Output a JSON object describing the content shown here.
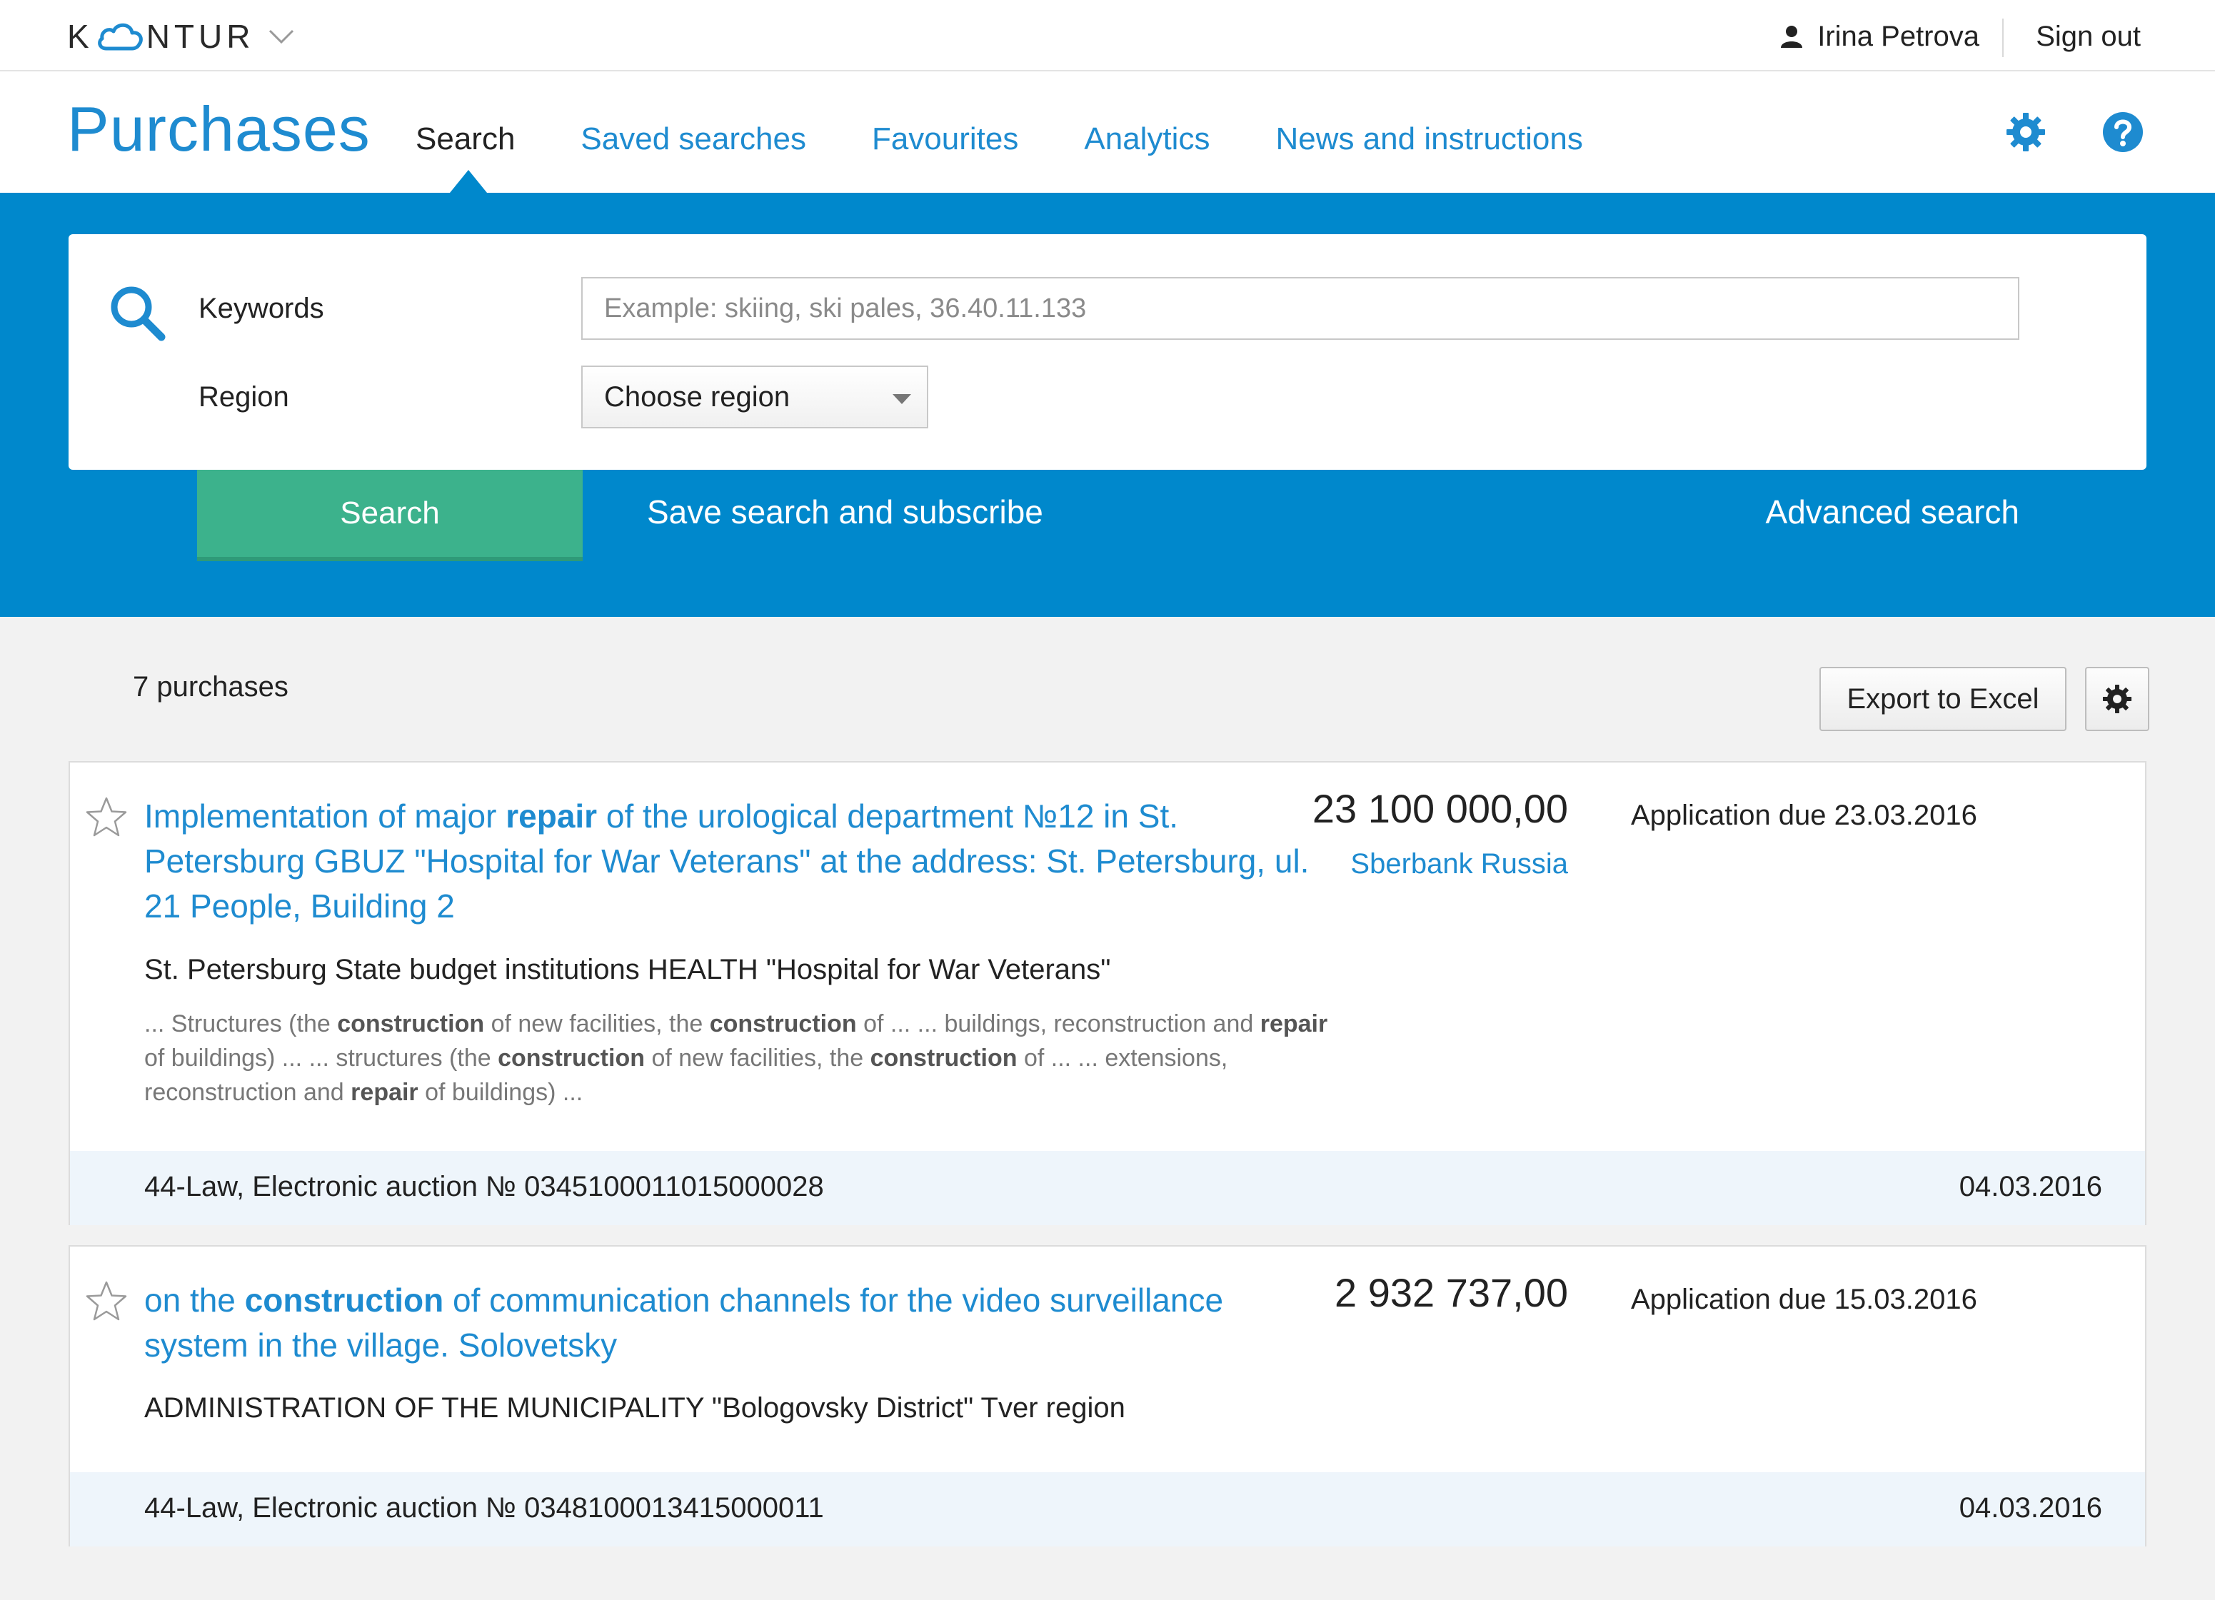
{
  "brand": {
    "logo_text_left": "K",
    "logo_text_right": "NTUR"
  },
  "user": {
    "name": "Irina Petrova",
    "sign_out": "Sign out"
  },
  "nav": {
    "product_title": "Purchases",
    "tabs": [
      {
        "label": "Search",
        "active": true
      },
      {
        "label": "Saved searches",
        "active": false
      },
      {
        "label": "Favourites",
        "active": false
      },
      {
        "label": "Analytics",
        "active": false
      },
      {
        "label": "News and instructions",
        "active": false
      }
    ]
  },
  "search": {
    "keywords_label": "Keywords",
    "keywords_placeholder": "Example: skiing, ski pales, 36.40.11.133",
    "keywords_value": "",
    "region_label": "Region",
    "region_value": "Choose region",
    "search_button": "Search",
    "save_link": "Save search and subscribe",
    "advanced_link": "Advanced search"
  },
  "results": {
    "count_text": "7 purchases",
    "export_button": "Export to Excel",
    "items": [
      {
        "title_parts": [
          "Implementation of major ",
          "repair",
          " of the urological department №12 in St. Petersburg GBUZ \"Hospital for War Veterans\" at the address: St. Petersburg, ul. 21 People, Building 2"
        ],
        "price": "23 100 000,00",
        "bank": "Sberbank Russia",
        "due": "Application due 23.03.2016",
        "org": "St. Petersburg State budget institutions HEALTH \"Hospital for War Veterans\"",
        "snippet_parts": [
          "... Structures (the ",
          "construction",
          " of new facilities, the ",
          "construction",
          " of ... ... buildings, reconstruction and ",
          "repair",
          " of buildings) ... ... structures (the ",
          "construction",
          " of new facilities, the ",
          "construction",
          " of ... ... extensions, reconstruction and ",
          "repair",
          " of buildings) ..."
        ],
        "law": "44-Law, Electronic auction № 0345100011015000028",
        "date": "04.03.2016"
      },
      {
        "title_parts": [
          "on the ",
          "construction",
          " of communication channels for the video surveillance system in the village. Solovetsky"
        ],
        "price": "2 932 737,00",
        "bank": "",
        "due": "Application due 15.03.2016",
        "org": "ADMINISTRATION OF THE MUNICIPALITY \"Bologovsky District\" Tver region",
        "snippet_parts": [],
        "law": "44-Law, Electronic auction № 0348100013415000011",
        "date": "04.03.2016"
      }
    ]
  },
  "colors": {
    "accent": "#1e8bd0",
    "band": "#0088cc",
    "search_button": "#3cb28c",
    "footer": "#eef5fb"
  },
  "icons": [
    "cloud-icon",
    "chevron-down-icon",
    "user-icon",
    "gear-icon",
    "help-icon",
    "search-icon",
    "star-icon",
    "caret-down-icon"
  ]
}
